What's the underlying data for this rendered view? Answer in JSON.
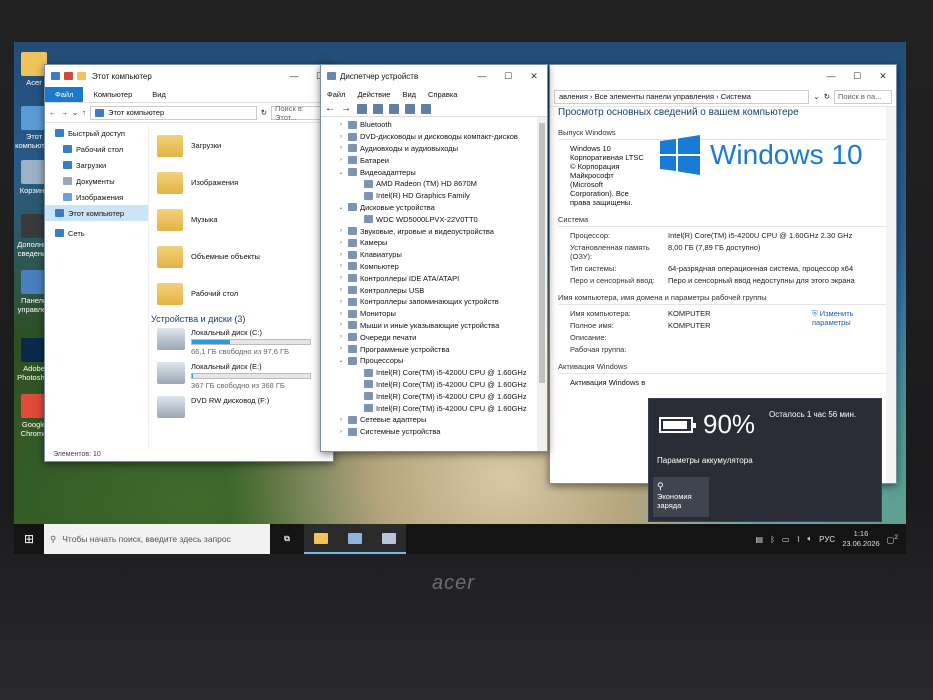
{
  "desktop_icons": [
    {
      "label": "Acer",
      "icon": "folder-icon"
    },
    {
      "label": "Этот компьютер",
      "icon": "computer-icon"
    },
    {
      "label": "Корзина",
      "icon": "recycle-bin-icon"
    },
    {
      "label": "Дополнит сведения",
      "icon": "info-icon"
    },
    {
      "label": "Панель управлен",
      "icon": "control-panel-icon"
    },
    {
      "label": "Adobe Photosh...",
      "icon": "photoshop-icon"
    },
    {
      "label": "Google Chrome",
      "icon": "chrome-icon"
    }
  ],
  "explorer": {
    "title": "Этот компьютер",
    "tabs": [
      "Файл",
      "Компьютер",
      "Вид"
    ],
    "address": "Этот компьютер",
    "search_placeholder": "Поиск в: Этот...",
    "nav": [
      {
        "label": "Быстрый доступ"
      },
      {
        "label": "Рабочий стол"
      },
      {
        "label": "Загрузки"
      },
      {
        "label": "Документы"
      },
      {
        "label": "Изображения"
      },
      {
        "label": "Этот компьютер"
      },
      {
        "label": "Сеть"
      }
    ],
    "folders": [
      "Загрузки",
      "Изображения",
      "Музыка",
      "Объемные объекты",
      "Рабочий стол"
    ],
    "drives_header": "Устройства и диски (3)",
    "drives": [
      {
        "name": "Локальный диск (C:)",
        "free": "66,1 ГБ свободно из 97,6 ГБ",
        "used_fraction": 0.32
      },
      {
        "name": "Локальный диск (E:)",
        "free": "367 ГБ свободно из 368 ГБ",
        "used_fraction": 0.01
      },
      {
        "name": "DVD RW дисковод (F:)",
        "free": ""
      }
    ],
    "status": "Элементов: 10"
  },
  "device_manager": {
    "title": "Диспетчер устройств",
    "menu": [
      "Файл",
      "Действие",
      "Вид",
      "Справка"
    ],
    "tree": [
      {
        "label": "Bluetooth",
        "level": 1,
        "arrow": "›"
      },
      {
        "label": "DVD-дисководы и дисководы компакт-дисков",
        "level": 1,
        "arrow": "›"
      },
      {
        "label": "Аудиовходы и аудиовыходы",
        "level": 1,
        "arrow": "›"
      },
      {
        "label": "Батареи",
        "level": 1,
        "arrow": "›"
      },
      {
        "label": "Видеоадаптеры",
        "level": 1,
        "arrow": "⌄"
      },
      {
        "label": "AMD Radeon (TM) HD 8670M",
        "level": 2,
        "arrow": ""
      },
      {
        "label": "Intel(R) HD Graphics Family",
        "level": 2,
        "arrow": ""
      },
      {
        "label": "Дисковые устройства",
        "level": 1,
        "arrow": "⌄"
      },
      {
        "label": "WDC WD5000LPVX-22V0TT0",
        "level": 2,
        "arrow": ""
      },
      {
        "label": "Звуковые, игровые и видеоустройства",
        "level": 1,
        "arrow": "›"
      },
      {
        "label": "Камеры",
        "level": 1,
        "arrow": "›"
      },
      {
        "label": "Клавиатуры",
        "level": 1,
        "arrow": "›"
      },
      {
        "label": "Компьютер",
        "level": 1,
        "arrow": "›"
      },
      {
        "label": "Контроллеры IDE ATA/ATAPI",
        "level": 1,
        "arrow": "›"
      },
      {
        "label": "Контроллеры USB",
        "level": 1,
        "arrow": "›"
      },
      {
        "label": "Контроллеры запоминающих устройств",
        "level": 1,
        "arrow": "›"
      },
      {
        "label": "Мониторы",
        "level": 1,
        "arrow": "›"
      },
      {
        "label": "Мыши и иные указывающие устройства",
        "level": 1,
        "arrow": "›"
      },
      {
        "label": "Очереди печати",
        "level": 1,
        "arrow": "›"
      },
      {
        "label": "Программные устройства",
        "level": 1,
        "arrow": "›"
      },
      {
        "label": "Процессоры",
        "level": 1,
        "arrow": "⌄"
      },
      {
        "label": "Intel(R) Core(TM) i5-4200U CPU @ 1.60GHz",
        "level": 2,
        "arrow": ""
      },
      {
        "label": "Intel(R) Core(TM) i5-4200U CPU @ 1.60GHz",
        "level": 2,
        "arrow": ""
      },
      {
        "label": "Intel(R) Core(TM) i5-4200U CPU @ 1.60GHz",
        "level": 2,
        "arrow": ""
      },
      {
        "label": "Intel(R) Core(TM) i5-4200U CPU @ 1.60GHz",
        "level": 2,
        "arrow": ""
      },
      {
        "label": "Сетевые адаптеры",
        "level": 1,
        "arrow": "›"
      },
      {
        "label": "Системные устройства",
        "level": 1,
        "arrow": "›"
      }
    ]
  },
  "system": {
    "breadcrumb": "авления › Все элементы панели управления › Система",
    "search_placeholder": "Поиск в па...",
    "heading": "Просмотр основных сведений о вашем компьютере",
    "edition_section": "Выпуск Windows",
    "edition_lines": [
      "Windows 10",
      "Корпоративная LTSC",
      "© Корпорация",
      "Майкрософт",
      "(Microsoft",
      "Corporation). Все",
      "права защищены."
    ],
    "logo_text": "Windows 10",
    "system_section": "Система",
    "system_rows": [
      {
        "k": "Процессор:",
        "v": "Intel(R) Core(TM) i5-4200U CPU @ 1.60GHz   2.30 GHz"
      },
      {
        "k": "Установленная память (ОЗУ):",
        "v": "8,00 ГБ (7,89 ГБ доступно)"
      },
      {
        "k": "Тип системы:",
        "v": "64-разрядная операционная система, процессор x64"
      },
      {
        "k": "Перо и сенсорный ввод:",
        "v": "Перо и сенсорный ввод недоступны для этого экрана"
      }
    ],
    "name_section": "Имя компьютера, имя домена и параметры рабочей группы",
    "name_rows": [
      {
        "k": "Имя компьютера:",
        "v": "KOMPUTER"
      },
      {
        "k": "Полное имя:",
        "v": "KOMPUTER"
      },
      {
        "k": "Описание:",
        "v": ""
      },
      {
        "k": "Рабочая группа:",
        "v": ""
      }
    ],
    "change_link": "Изменить параметры",
    "activation_section": "Активация Windows",
    "activation_text": "Активация Windows в"
  },
  "battery": {
    "percent": "90%",
    "remaining": "Осталось 1 час 56 мин.",
    "settings_link": "Параметры аккумулятора",
    "saver_label": "Экономия заряда"
  },
  "taskbar": {
    "search_placeholder": "Чтобы начать поиск, введите здесь запрос",
    "lang": "РУС",
    "time": "1:16",
    "date": "23.06.2026",
    "notifications": "2"
  },
  "laptop_brand": "acer",
  "colors": {
    "accent": "#1979ca",
    "windows_blue": "#1a7bd4",
    "flyout_bg": "#2a2d35"
  }
}
